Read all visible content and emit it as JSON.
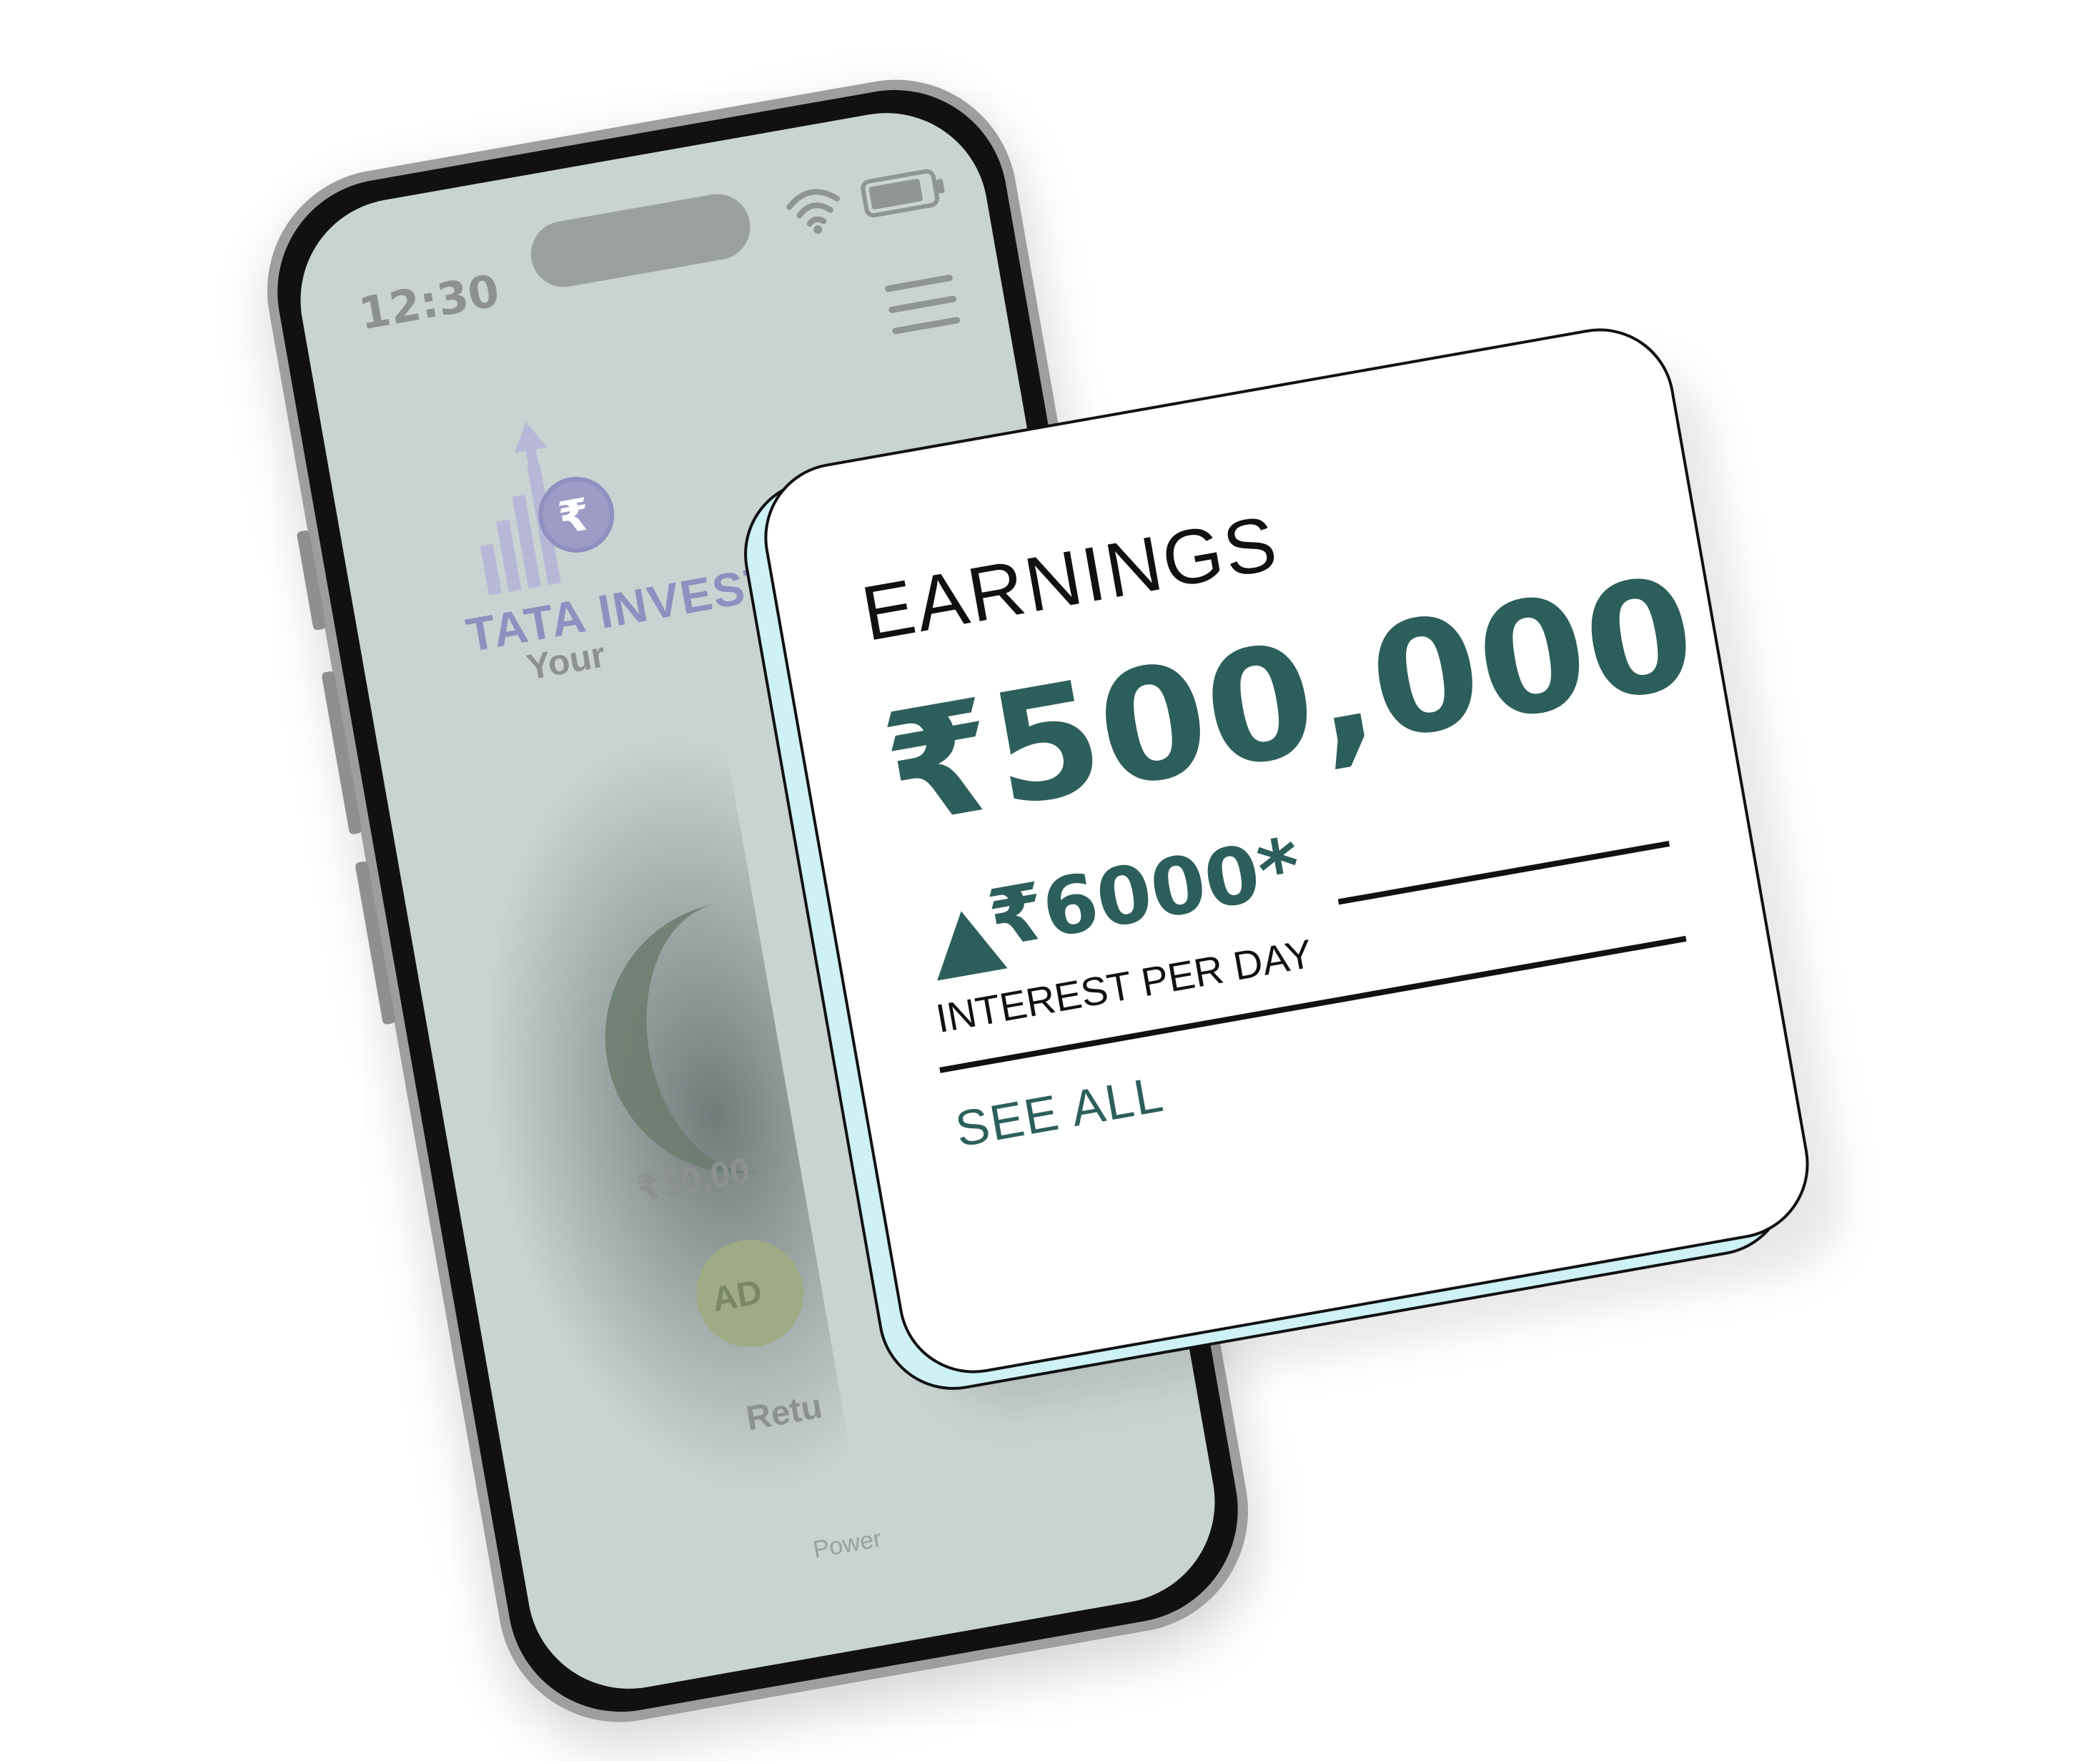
{
  "phone": {
    "status_time": "12:30",
    "brand": {
      "name": "TATA INVEST",
      "tagline_partial": "Your",
      "logo_symbol": "₹"
    },
    "amount_partial": "₹10,00",
    "add_button_partial": "AD",
    "returns_partial": "Retu",
    "powered_partial": "Power"
  },
  "earnings_card": {
    "title": "EARNINGS",
    "amount": "₹500,000",
    "interest_amount": "₹6000*",
    "interest_label": "INTEREST PER DAY",
    "see_all": "SEE ALL",
    "arrow_icon": "triangle-up-icon"
  },
  "colors": {
    "accent_teal": "#2c5f5b",
    "card_back": "#cdf1f4",
    "phone_screen": "#c9d3d1",
    "brand_purple": "#8f8fc0"
  }
}
